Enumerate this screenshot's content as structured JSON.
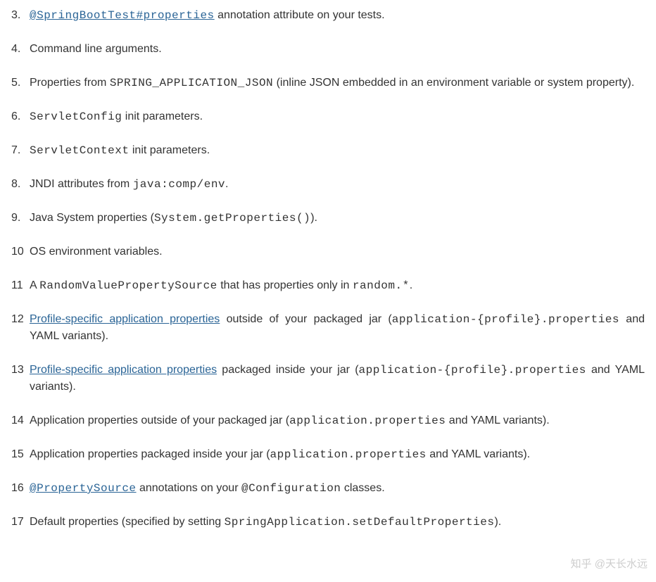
{
  "items": [
    {
      "segments": [
        {
          "type": "link",
          "code": true,
          "text": "@SpringBootTest#properties"
        },
        {
          "type": "text",
          "text": " annotation attribute on your tests."
        }
      ]
    },
    {
      "segments": [
        {
          "type": "text",
          "text": "Command line arguments."
        }
      ]
    },
    {
      "segments": [
        {
          "type": "text",
          "text": "Properties from "
        },
        {
          "type": "code",
          "text": "SPRING_APPLICATION_JSON"
        },
        {
          "type": "text",
          "text": " (inline JSON embedded in an environment variable or system property)."
        }
      ]
    },
    {
      "segments": [
        {
          "type": "code",
          "text": "ServletConfig"
        },
        {
          "type": "text",
          "text": " init parameters."
        }
      ]
    },
    {
      "segments": [
        {
          "type": "code",
          "text": "ServletContext"
        },
        {
          "type": "text",
          "text": " init parameters."
        }
      ]
    },
    {
      "segments": [
        {
          "type": "text",
          "text": "JNDI attributes from "
        },
        {
          "type": "code",
          "text": "java:comp/env"
        },
        {
          "type": "text",
          "text": "."
        }
      ]
    },
    {
      "segments": [
        {
          "type": "text",
          "text": "Java System properties ("
        },
        {
          "type": "code",
          "text": "System.getProperties()"
        },
        {
          "type": "text",
          "text": ")."
        }
      ]
    },
    {
      "segments": [
        {
          "type": "text",
          "text": "OS environment variables."
        }
      ]
    },
    {
      "segments": [
        {
          "type": "text",
          "text": "A "
        },
        {
          "type": "code",
          "text": "RandomValuePropertySource"
        },
        {
          "type": "text",
          "text": " that has properties only in "
        },
        {
          "type": "code",
          "text": "random.*"
        },
        {
          "type": "text",
          "text": "."
        }
      ]
    },
    {
      "segments": [
        {
          "type": "link",
          "text": "Profile-specific application properties"
        },
        {
          "type": "text",
          "text": " outside of your packaged jar ("
        },
        {
          "type": "code",
          "text": "application-{profile}.properties"
        },
        {
          "type": "text",
          "text": " and YAML variants)."
        }
      ]
    },
    {
      "segments": [
        {
          "type": "link",
          "text": "Profile-specific application properties"
        },
        {
          "type": "text",
          "text": " packaged inside your jar ("
        },
        {
          "type": "code",
          "text": "application-{profile}.properties"
        },
        {
          "type": "text",
          "text": " and YAML variants)."
        }
      ]
    },
    {
      "segments": [
        {
          "type": "text",
          "text": "Application properties outside of your packaged jar ("
        },
        {
          "type": "code",
          "text": "application.properties"
        },
        {
          "type": "text",
          "text": " and YAML variants)."
        }
      ]
    },
    {
      "segments": [
        {
          "type": "text",
          "text": "Application properties packaged inside your jar ("
        },
        {
          "type": "code",
          "text": "application.properties"
        },
        {
          "type": "text",
          "text": " and YAML variants)."
        }
      ]
    },
    {
      "segments": [
        {
          "type": "link",
          "code": true,
          "text": "@PropertySource"
        },
        {
          "type": "text",
          "text": " annotations on your "
        },
        {
          "type": "code",
          "text": "@Configuration"
        },
        {
          "type": "text",
          "text": " classes."
        }
      ]
    },
    {
      "segments": [
        {
          "type": "text",
          "text": "Default properties (specified by setting "
        },
        {
          "type": "code",
          "text": "SpringApplication.setDefaultProperties"
        },
        {
          "type": "text",
          "text": ")."
        }
      ]
    }
  ],
  "watermark": "知乎 @天长水远"
}
